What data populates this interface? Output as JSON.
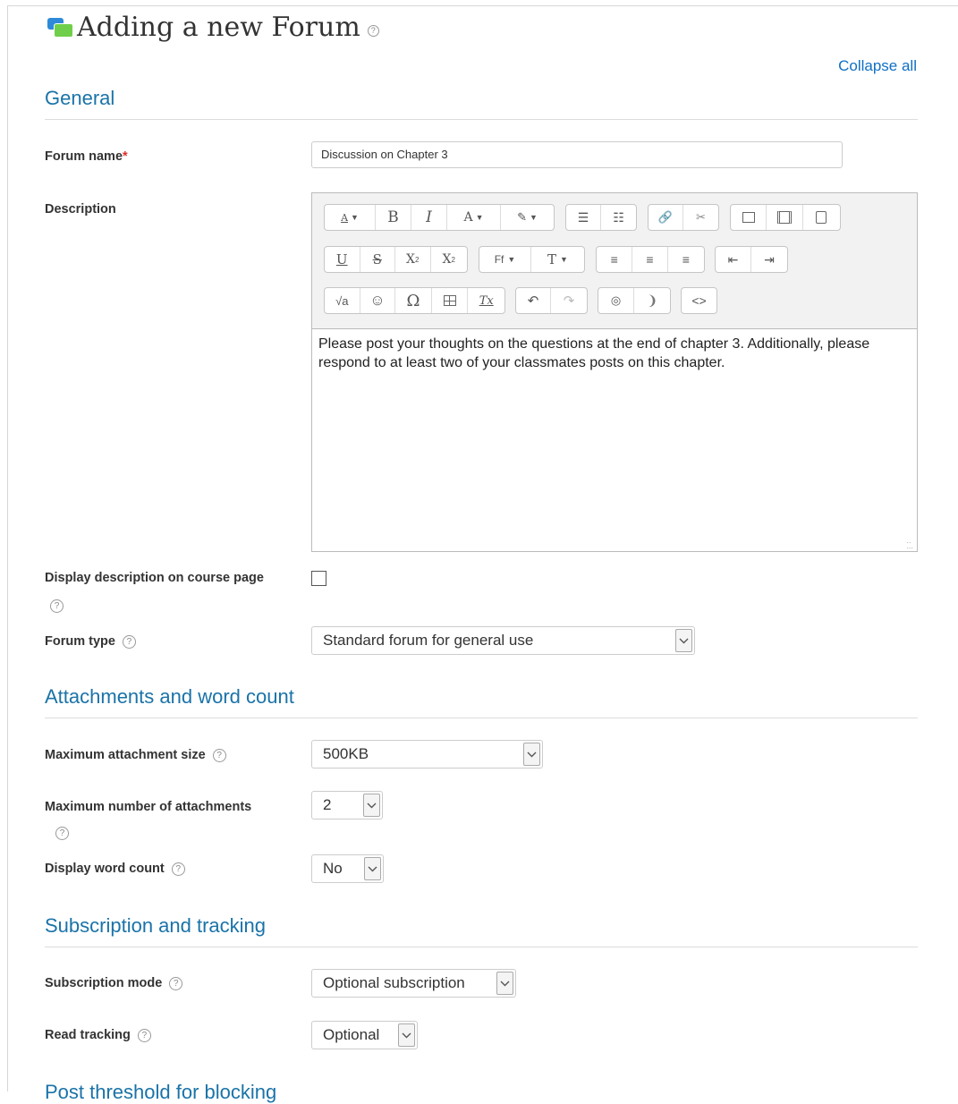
{
  "page": {
    "title": "Adding a new Forum",
    "collapse_all": "Collapse all"
  },
  "general": {
    "heading": "General",
    "forum_name": {
      "label": "Forum name",
      "required_mark": "*",
      "value": "Discussion on Chapter 3"
    },
    "description": {
      "label": "Description",
      "content": "Please post your thoughts on the questions at the end of chapter 3. Additionally, please respond to at least two of your classmates posts on this chapter."
    },
    "display_description": {
      "label": "Display description on course page",
      "checked": false
    },
    "forum_type": {
      "label": "Forum type",
      "value": "Standard forum for general use"
    }
  },
  "toolbar": {
    "font_size": "A",
    "bold": "B",
    "italic": "I",
    "text_color": "A",
    "font_family": "Ff",
    "paragraph": "T",
    "underline": "U",
    "strike": "S",
    "subscript": "X",
    "superscript": "X",
    "equation": "√a",
    "special_char": "Ω",
    "clear": "Tx"
  },
  "attachments": {
    "heading": "Attachments and word count",
    "max_size": {
      "label": "Maximum attachment size",
      "value": "500KB"
    },
    "max_number": {
      "label": "Maximum number of attachments",
      "value": "2"
    },
    "word_count": {
      "label": "Display word count",
      "value": "No"
    }
  },
  "subscription": {
    "heading": "Subscription and tracking",
    "mode": {
      "label": "Subscription mode",
      "value": "Optional subscription"
    },
    "read_tracking": {
      "label": "Read tracking",
      "value": "Optional"
    }
  },
  "next_section_partial": "Post threshold for blocking",
  "icons": [
    "forum-icon",
    "help-icon",
    "chevron-down-icon"
  ]
}
